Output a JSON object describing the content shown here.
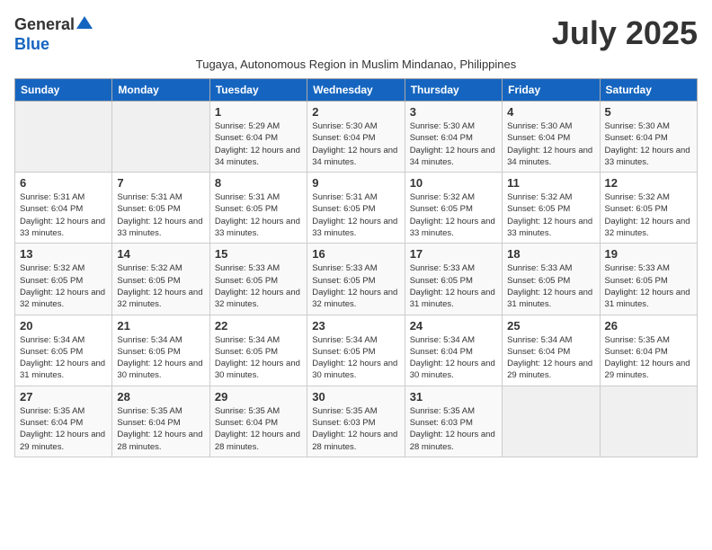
{
  "header": {
    "logo_general": "General",
    "logo_blue": "Blue",
    "month_title": "July 2025",
    "subtitle": "Tugaya, Autonomous Region in Muslim Mindanao, Philippines"
  },
  "days_of_week": [
    "Sunday",
    "Monday",
    "Tuesday",
    "Wednesday",
    "Thursday",
    "Friday",
    "Saturday"
  ],
  "weeks": [
    [
      {
        "day": "",
        "info": ""
      },
      {
        "day": "",
        "info": ""
      },
      {
        "day": "1",
        "info": "Sunrise: 5:29 AM\nSunset: 6:04 PM\nDaylight: 12 hours and 34 minutes."
      },
      {
        "day": "2",
        "info": "Sunrise: 5:30 AM\nSunset: 6:04 PM\nDaylight: 12 hours and 34 minutes."
      },
      {
        "day": "3",
        "info": "Sunrise: 5:30 AM\nSunset: 6:04 PM\nDaylight: 12 hours and 34 minutes."
      },
      {
        "day": "4",
        "info": "Sunrise: 5:30 AM\nSunset: 6:04 PM\nDaylight: 12 hours and 34 minutes."
      },
      {
        "day": "5",
        "info": "Sunrise: 5:30 AM\nSunset: 6:04 PM\nDaylight: 12 hours and 33 minutes."
      }
    ],
    [
      {
        "day": "6",
        "info": "Sunrise: 5:31 AM\nSunset: 6:04 PM\nDaylight: 12 hours and 33 minutes."
      },
      {
        "day": "7",
        "info": "Sunrise: 5:31 AM\nSunset: 6:05 PM\nDaylight: 12 hours and 33 minutes."
      },
      {
        "day": "8",
        "info": "Sunrise: 5:31 AM\nSunset: 6:05 PM\nDaylight: 12 hours and 33 minutes."
      },
      {
        "day": "9",
        "info": "Sunrise: 5:31 AM\nSunset: 6:05 PM\nDaylight: 12 hours and 33 minutes."
      },
      {
        "day": "10",
        "info": "Sunrise: 5:32 AM\nSunset: 6:05 PM\nDaylight: 12 hours and 33 minutes."
      },
      {
        "day": "11",
        "info": "Sunrise: 5:32 AM\nSunset: 6:05 PM\nDaylight: 12 hours and 33 minutes."
      },
      {
        "day": "12",
        "info": "Sunrise: 5:32 AM\nSunset: 6:05 PM\nDaylight: 12 hours and 32 minutes."
      }
    ],
    [
      {
        "day": "13",
        "info": "Sunrise: 5:32 AM\nSunset: 6:05 PM\nDaylight: 12 hours and 32 minutes."
      },
      {
        "day": "14",
        "info": "Sunrise: 5:32 AM\nSunset: 6:05 PM\nDaylight: 12 hours and 32 minutes."
      },
      {
        "day": "15",
        "info": "Sunrise: 5:33 AM\nSunset: 6:05 PM\nDaylight: 12 hours and 32 minutes."
      },
      {
        "day": "16",
        "info": "Sunrise: 5:33 AM\nSunset: 6:05 PM\nDaylight: 12 hours and 32 minutes."
      },
      {
        "day": "17",
        "info": "Sunrise: 5:33 AM\nSunset: 6:05 PM\nDaylight: 12 hours and 31 minutes."
      },
      {
        "day": "18",
        "info": "Sunrise: 5:33 AM\nSunset: 6:05 PM\nDaylight: 12 hours and 31 minutes."
      },
      {
        "day": "19",
        "info": "Sunrise: 5:33 AM\nSunset: 6:05 PM\nDaylight: 12 hours and 31 minutes."
      }
    ],
    [
      {
        "day": "20",
        "info": "Sunrise: 5:34 AM\nSunset: 6:05 PM\nDaylight: 12 hours and 31 minutes."
      },
      {
        "day": "21",
        "info": "Sunrise: 5:34 AM\nSunset: 6:05 PM\nDaylight: 12 hours and 30 minutes."
      },
      {
        "day": "22",
        "info": "Sunrise: 5:34 AM\nSunset: 6:05 PM\nDaylight: 12 hours and 30 minutes."
      },
      {
        "day": "23",
        "info": "Sunrise: 5:34 AM\nSunset: 6:05 PM\nDaylight: 12 hours and 30 minutes."
      },
      {
        "day": "24",
        "info": "Sunrise: 5:34 AM\nSunset: 6:04 PM\nDaylight: 12 hours and 30 minutes."
      },
      {
        "day": "25",
        "info": "Sunrise: 5:34 AM\nSunset: 6:04 PM\nDaylight: 12 hours and 29 minutes."
      },
      {
        "day": "26",
        "info": "Sunrise: 5:35 AM\nSunset: 6:04 PM\nDaylight: 12 hours and 29 minutes."
      }
    ],
    [
      {
        "day": "27",
        "info": "Sunrise: 5:35 AM\nSunset: 6:04 PM\nDaylight: 12 hours and 29 minutes."
      },
      {
        "day": "28",
        "info": "Sunrise: 5:35 AM\nSunset: 6:04 PM\nDaylight: 12 hours and 28 minutes."
      },
      {
        "day": "29",
        "info": "Sunrise: 5:35 AM\nSunset: 6:04 PM\nDaylight: 12 hours and 28 minutes."
      },
      {
        "day": "30",
        "info": "Sunrise: 5:35 AM\nSunset: 6:03 PM\nDaylight: 12 hours and 28 minutes."
      },
      {
        "day": "31",
        "info": "Sunrise: 5:35 AM\nSunset: 6:03 PM\nDaylight: 12 hours and 28 minutes."
      },
      {
        "day": "",
        "info": ""
      },
      {
        "day": "",
        "info": ""
      }
    ]
  ]
}
